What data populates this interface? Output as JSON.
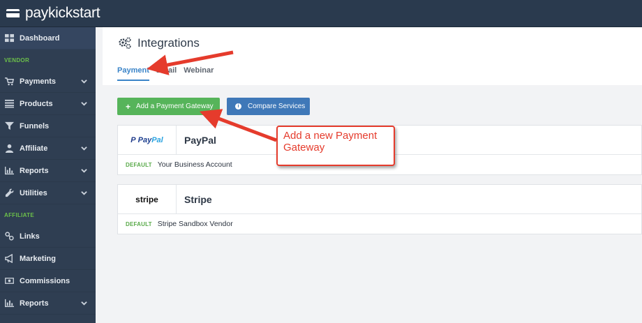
{
  "app": {
    "brand": "paykickstart"
  },
  "sidebar": {
    "top": {
      "label": "Dashboard",
      "icon": "dashboard-icon"
    },
    "vendor_section": "VENDOR",
    "vendor_items": [
      {
        "label": "Payments",
        "icon": "cart-icon"
      },
      {
        "label": "Products",
        "icon": "list-icon"
      },
      {
        "label": "Funnels",
        "icon": "funnel-icon"
      },
      {
        "label": "Affiliate",
        "icon": "user-icon"
      },
      {
        "label": "Reports",
        "icon": "bar-chart-icon"
      },
      {
        "label": "Utilities",
        "icon": "wrench-icon"
      }
    ],
    "affiliate_section": "AFFILIATE",
    "affiliate_items": [
      {
        "label": "Links",
        "icon": "link-icon"
      },
      {
        "label": "Marketing",
        "icon": "megaphone-icon"
      },
      {
        "label": "Commissions",
        "icon": "money-icon"
      },
      {
        "label": "Reports",
        "icon": "bar-chart-icon"
      }
    ]
  },
  "header": {
    "title": "Integrations",
    "tabs": [
      {
        "label": "Payment",
        "active": true
      },
      {
        "label": "Email",
        "active": false
      },
      {
        "label": "Webinar",
        "active": false
      }
    ]
  },
  "actions": {
    "add_gateway": "Add a Payment Gateway",
    "compare": "Compare Services"
  },
  "gateways": [
    {
      "name": "PayPal",
      "logo_text_1": "Pay",
      "logo_text_2": "Pal",
      "badge": "DEFAULT",
      "account": "Your Business Account"
    },
    {
      "name": "Stripe",
      "logo_text": "stripe",
      "badge": "DEFAULT",
      "account": "Stripe Sandbox Vendor"
    }
  ],
  "annotation": {
    "text": "Add a new Payment Gateway",
    "color": "#e53b2c"
  },
  "colors": {
    "topbar": "#2a3a4e",
    "sidebar": "#2f3e52",
    "section_label": "#6cc04a",
    "active_tab": "#3a84c8",
    "add_button": "#56b45a",
    "compare_button": "#3f78b8"
  }
}
